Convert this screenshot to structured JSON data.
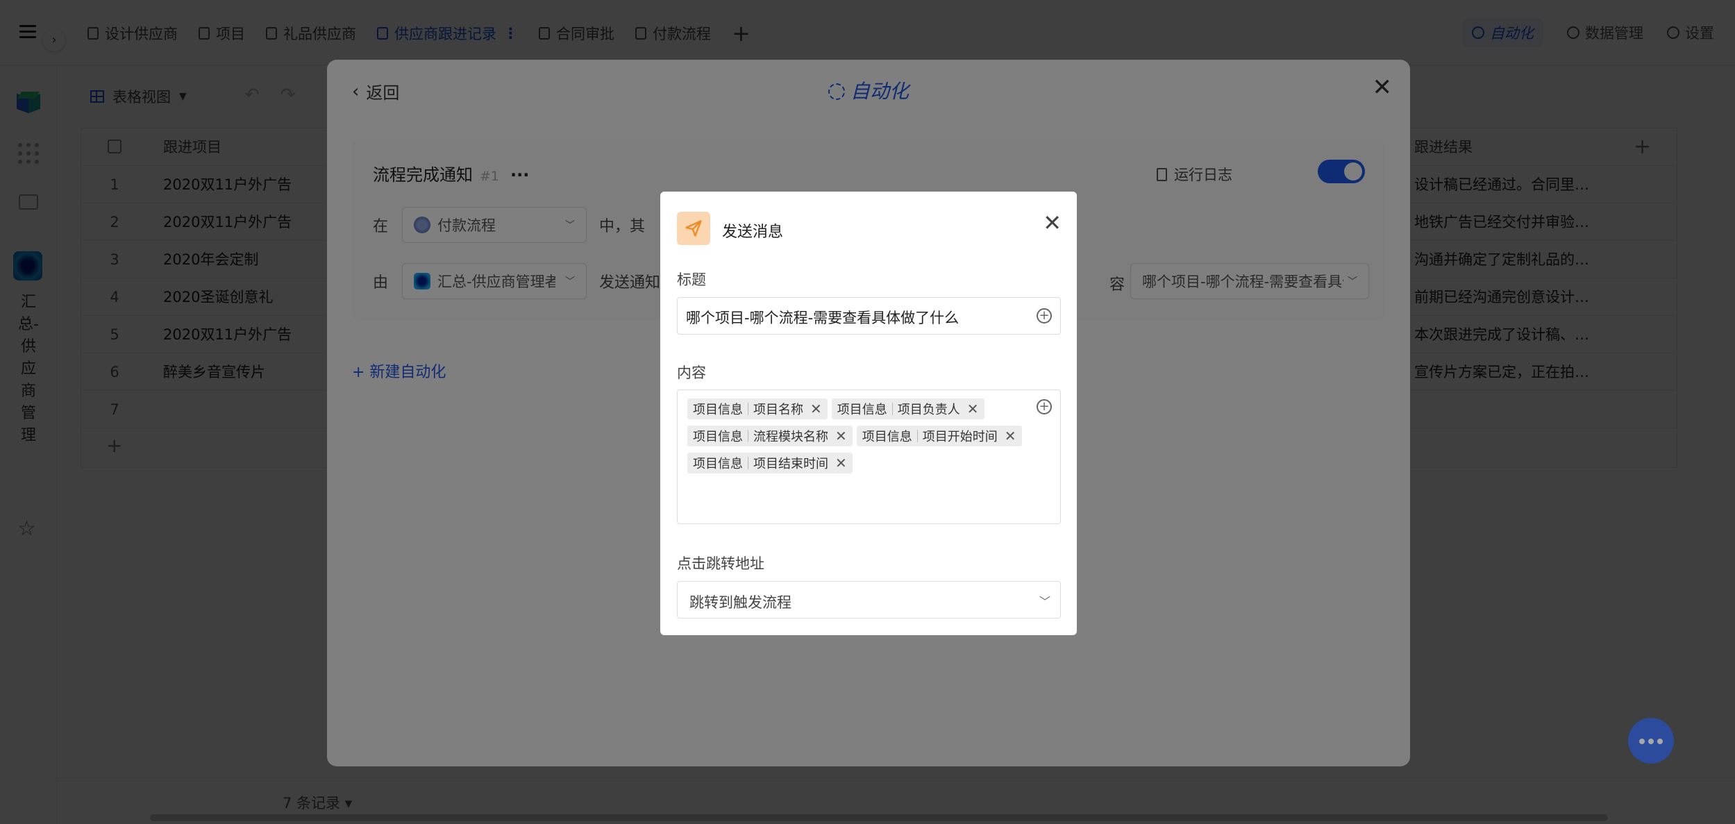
{
  "topbar": {
    "tabs": [
      {
        "label": "设计供应商",
        "active": false
      },
      {
        "label": "项目",
        "active": false
      },
      {
        "label": "礼品供应商",
        "active": false
      },
      {
        "label": "供应商跟进记录",
        "active": true
      },
      {
        "label": "合同审批",
        "active": false
      },
      {
        "label": "付款流程",
        "active": false
      }
    ],
    "right": {
      "automation": "自动化",
      "data_manage": "数据管理",
      "settings": "设置"
    }
  },
  "sidebar": {
    "workspace_name": "汇总-供应商管理"
  },
  "toolbar": {
    "view_label": "表格视图"
  },
  "table": {
    "headers": {
      "col1": "跟进项目",
      "col2": "跟进结果"
    },
    "rows": [
      {
        "num": "1",
        "project": "2020双11户外广告",
        "result": "设计稿已经通过。合同里…"
      },
      {
        "num": "2",
        "project": "2020双11户外广告",
        "result": "地铁广告已经交付并审验…"
      },
      {
        "num": "3",
        "project": "2020年会定制",
        "result": "沟通并确定了定制礼品的…"
      },
      {
        "num": "4",
        "project": "2020圣诞创意礼",
        "result": "前期已经沟通完创意设计…"
      },
      {
        "num": "5",
        "project": "2020双11户外广告",
        "result": "本次跟进完成了设计稿、…"
      },
      {
        "num": "6",
        "project": "醉美乡音宣传片",
        "result": "宣传片方案已定，正在拍…"
      },
      {
        "num": "7",
        "project": "",
        "result": ""
      }
    ],
    "record_count": "7 条记录"
  },
  "automation": {
    "back_label": "返回",
    "title": "自动化",
    "flow": {
      "name": "流程完成通知",
      "id": "#1",
      "run_log": "运行日志",
      "enabled": true,
      "line1_prefix": "在",
      "line1_select": "付款流程",
      "line1_suffix": "中，其",
      "line2_prefix": "由",
      "line2_select": "汇总-供应商管理者",
      "line2_suffix": "发送通知",
      "content_label": "容",
      "content_select": "哪个项目-哪个流程-需要查看具体"
    },
    "new_label": "+ 新建自动化"
  },
  "dialog": {
    "title": "发送消息",
    "title_label": "标题",
    "title_value": "哪个项目-哪个流程-需要查看具体做了什么",
    "content_label": "内容",
    "tags": [
      {
        "group": "项目信息",
        "field": "项目名称"
      },
      {
        "group": "项目信息",
        "field": "项目负责人"
      },
      {
        "group": "项目信息",
        "field": "流程模块名称"
      },
      {
        "group": "项目信息",
        "field": "项目开始时间"
      },
      {
        "group": "项目信息",
        "field": "项目结束时间"
      }
    ],
    "jump_label": "点击跳转地址",
    "jump_value": "跳转到触发流程"
  },
  "colors": {
    "accent": "#1e56e8",
    "overlay": "rgba(0,0,0,0.5)",
    "send_icon_bg": "#fbd6b0",
    "send_icon_fg": "#f08a24"
  }
}
